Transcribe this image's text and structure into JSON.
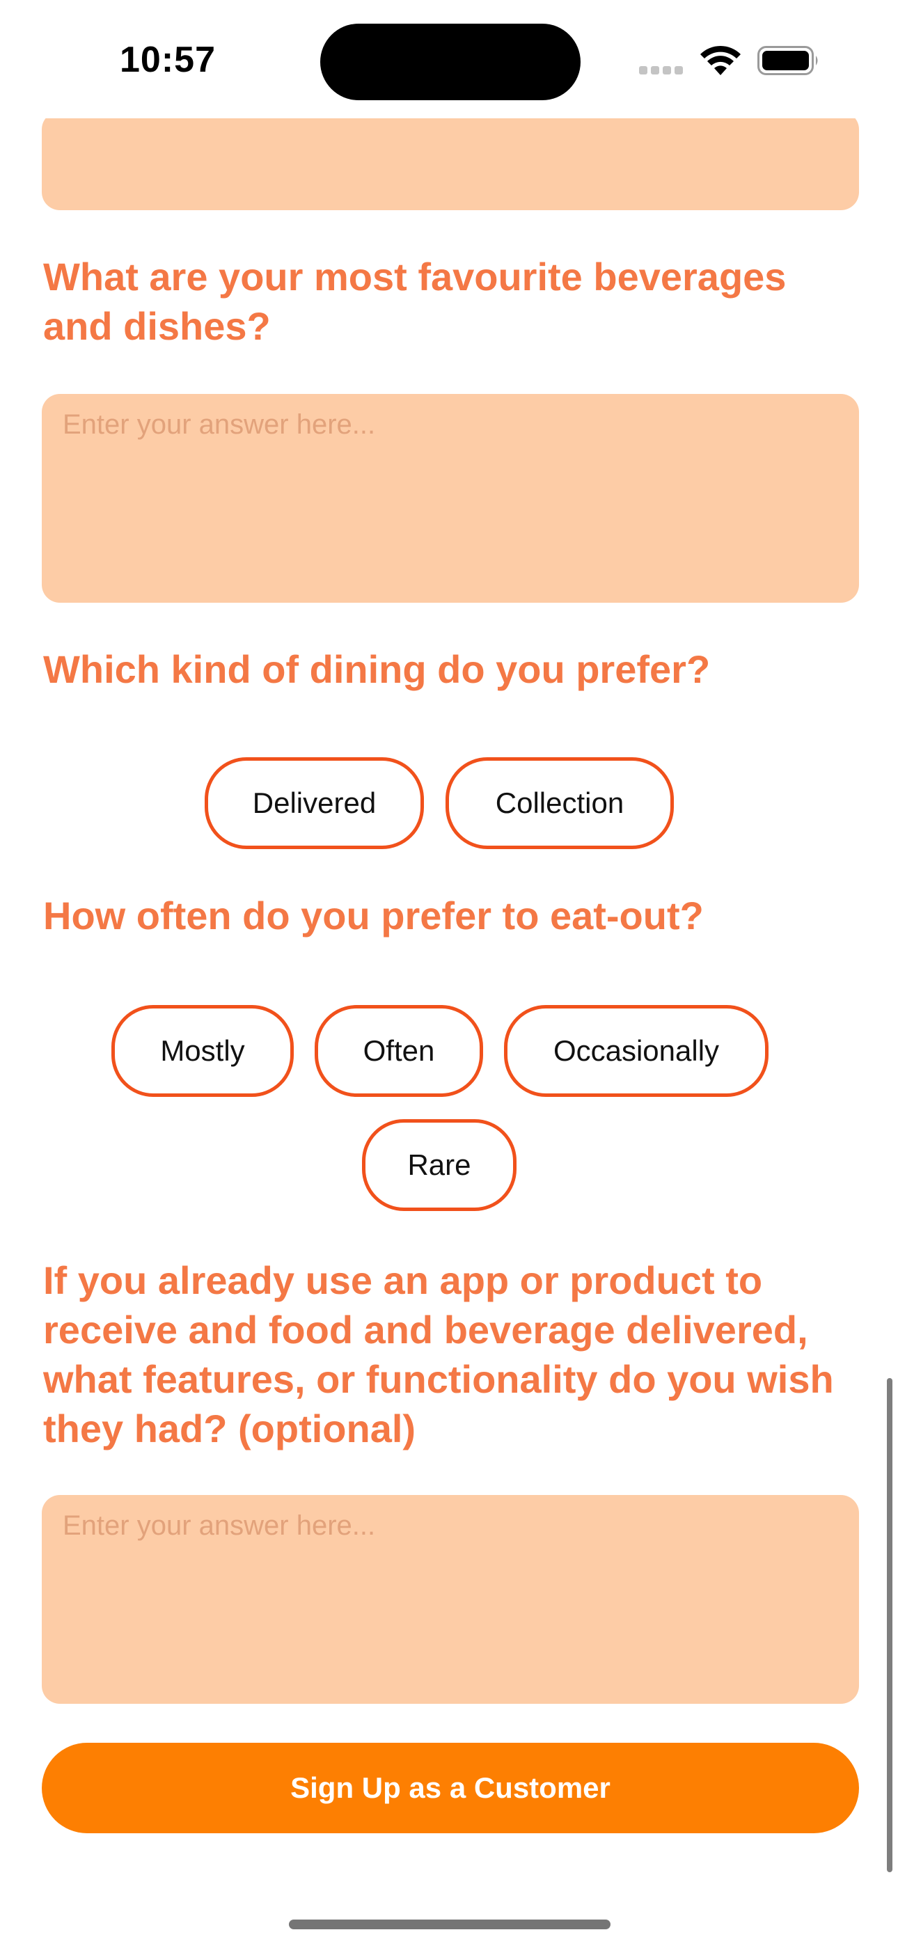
{
  "status_bar": {
    "time": "10:57"
  },
  "form": {
    "q_favourites": {
      "question": "What are your most favourite beverages and dishes?",
      "placeholder": "Enter your answer here..."
    },
    "q_dining": {
      "question": "Which kind of dining do you prefer?",
      "options": [
        "Delivered",
        "Collection"
      ]
    },
    "q_eat_out": {
      "question": "How often do you prefer to eat-out?",
      "options": [
        "Mostly",
        "Often",
        "Occasionally",
        "Rare"
      ]
    },
    "q_features": {
      "question": "If you already use an app or product to receive and food and beverage delivered, what features, or functionality do you wish they had? (optional)",
      "placeholder": "Enter your answer here..."
    },
    "submit_label": "Sign Up as a Customer"
  },
  "colors": {
    "question_text": "#f47845",
    "field_background": "#fdcca6",
    "chip_border": "#f1511b",
    "button_background": "#fd7f02"
  }
}
